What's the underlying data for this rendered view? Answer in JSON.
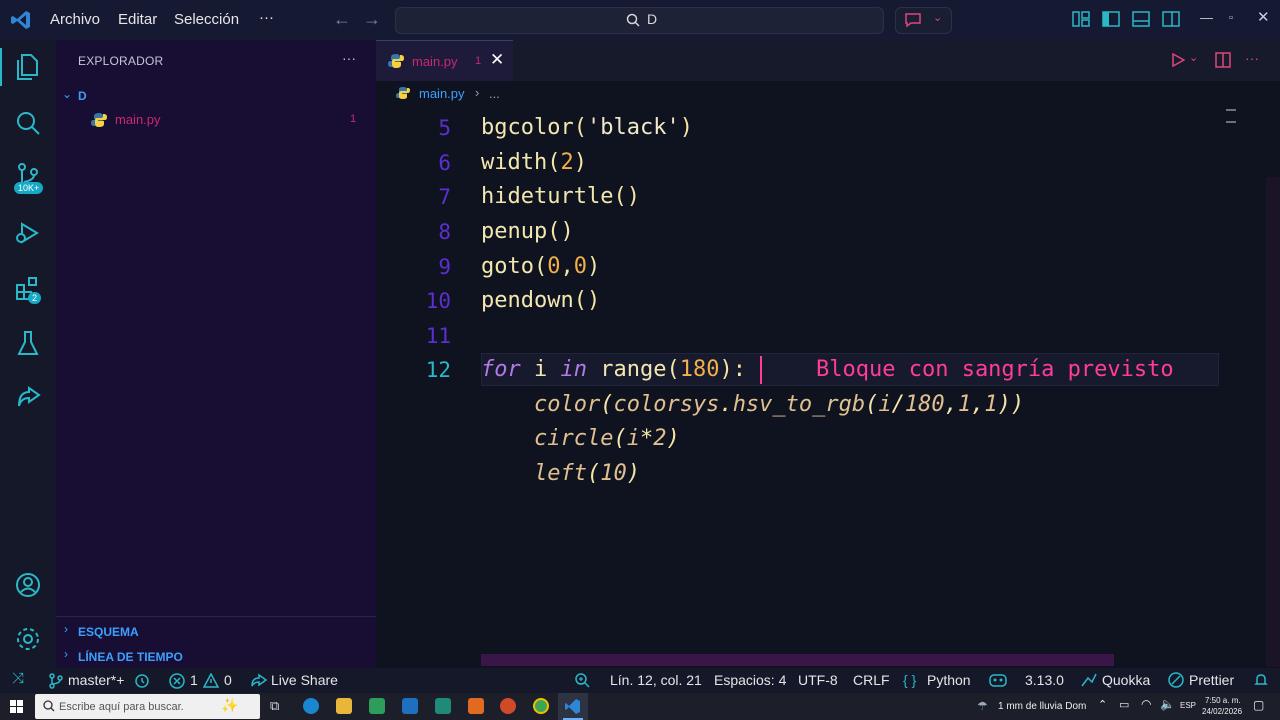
{
  "titlebar": {
    "menus": [
      "Archivo",
      "Editar",
      "Selección"
    ],
    "more": "···",
    "search_text": "D"
  },
  "activity": {
    "badges": [
      "10K+",
      "2"
    ]
  },
  "sidebar": {
    "title": "EXPLORADOR",
    "more": "···",
    "folder": "D",
    "file_name": "main.py",
    "file_problems": "1",
    "sections": [
      "ESQUEMA",
      "LÍNEA DE TIEMPO"
    ]
  },
  "tab": {
    "file_name": "main.py",
    "problems": "1"
  },
  "breadcrumbs": {
    "file": "main.py",
    "sep": "›",
    "rest": "..."
  },
  "editor": {
    "line_numbers": [
      "5",
      "6",
      "7",
      "8",
      "9",
      "10",
      "11",
      "12"
    ],
    "lines": [
      "bgcolor('black')",
      "width(2)",
      "hideturtle()",
      "penup()",
      "goto(0,0)",
      "pendown()",
      "",
      "for i in range(180):",
      "    color(colorsys.hsv_to_rgb(i/180,1,1))",
      "    circle(i*2)",
      "    left(10)"
    ],
    "diagnostic": "Bloque con sangría previsto"
  },
  "statusbar": {
    "branch": "master*+",
    "errors": "1",
    "warnings": "0",
    "live_share": "Live Share",
    "position": "Lín. 12, col. 21",
    "spaces": "Espacios: 4",
    "encoding": "UTF-8",
    "eol": "CRLF",
    "language": "Python",
    "version": "3.13.0",
    "quokka": "Quokka",
    "prettier": "Prettier"
  },
  "taskbar": {
    "search_placeholder": "Escribe aquí para buscar.",
    "weather": "1 mm de lluvia Dom",
    "lang": "ESP",
    "time": "7:50 a. m.",
    "date": "24/02/2026"
  },
  "colors": {
    "accent": "#2ab8c8",
    "diagnostic": "#ff3c9a",
    "line_numbers": "#5b2fd0",
    "sidebar_bg": "#180e33"
  }
}
